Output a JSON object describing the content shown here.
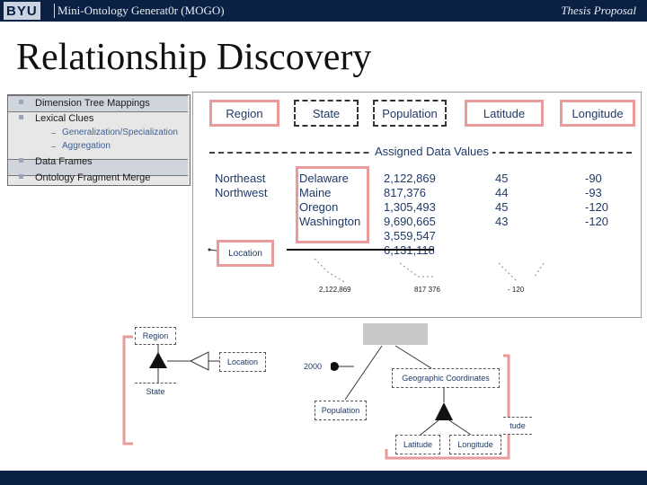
{
  "header": {
    "logo": "BYU",
    "title": "Mini-Ontology Generat0r (MOGO)",
    "right": "Thesis Proposal"
  },
  "slide_title": "Relationship Discovery",
  "outline": {
    "items": [
      {
        "label": "Dimension Tree Mappings"
      },
      {
        "label": "Lexical Clues"
      },
      {
        "label": "Data Frames"
      },
      {
        "label": "Ontology Fragment Merge"
      }
    ],
    "subitems": [
      "Generalization/Specialization",
      "Aggregation"
    ]
  },
  "table": {
    "headers": [
      "Region",
      "State",
      "Population",
      "Latitude",
      "Longitude"
    ],
    "assigned_label": "Assigned Data Values",
    "regions": [
      "Northeast",
      "Northwest"
    ],
    "states": [
      "Delaware",
      "Maine",
      "Oregon",
      "Washington"
    ],
    "populations": [
      "2,122,869",
      "817,376",
      "1,305,493",
      "9,690,665",
      "3,559,547",
      "6,131,118"
    ],
    "latitudes": [
      "45",
      "44",
      "45",
      "43"
    ],
    "longitudes": [
      "-90",
      "-93",
      "-120",
      "-120"
    ],
    "location_label": "Location",
    "small_values": [
      "2,122,869",
      "817 376",
      "- 120"
    ]
  },
  "diagram": {
    "region": "Region",
    "state": "State",
    "location": "Location",
    "year": "2000",
    "population": "Population",
    "geo": "Geographic Coordinates",
    "latitude": "Latitude",
    "longitude": "Longitude",
    "partial": "tude"
  },
  "colors": {
    "bar": "#0a2143",
    "accent_red": "#e99a9a"
  }
}
